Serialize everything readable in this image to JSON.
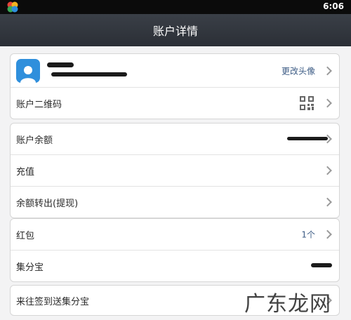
{
  "status_bar": {
    "time": "6:06"
  },
  "header": {
    "title": "账户详情"
  },
  "profile": {
    "change_avatar_label": "更改头像",
    "qrcode_label": "账户二维码"
  },
  "balance_section": {
    "balance_label": "账户余额",
    "recharge_label": "充值",
    "withdraw_label": "余额转出(提现)"
  },
  "rewards_section": {
    "red_packet_label": "红包",
    "red_packet_count": "1个",
    "points_label": "集分宝"
  },
  "promo_section": {
    "signin_label": "来往签到送集分宝"
  },
  "watermark": {
    "text": "广东龙网"
  },
  "colors": {
    "accent": "#2f8fdc",
    "link": "#3d5c85",
    "titlebar": "#2b2f36"
  }
}
